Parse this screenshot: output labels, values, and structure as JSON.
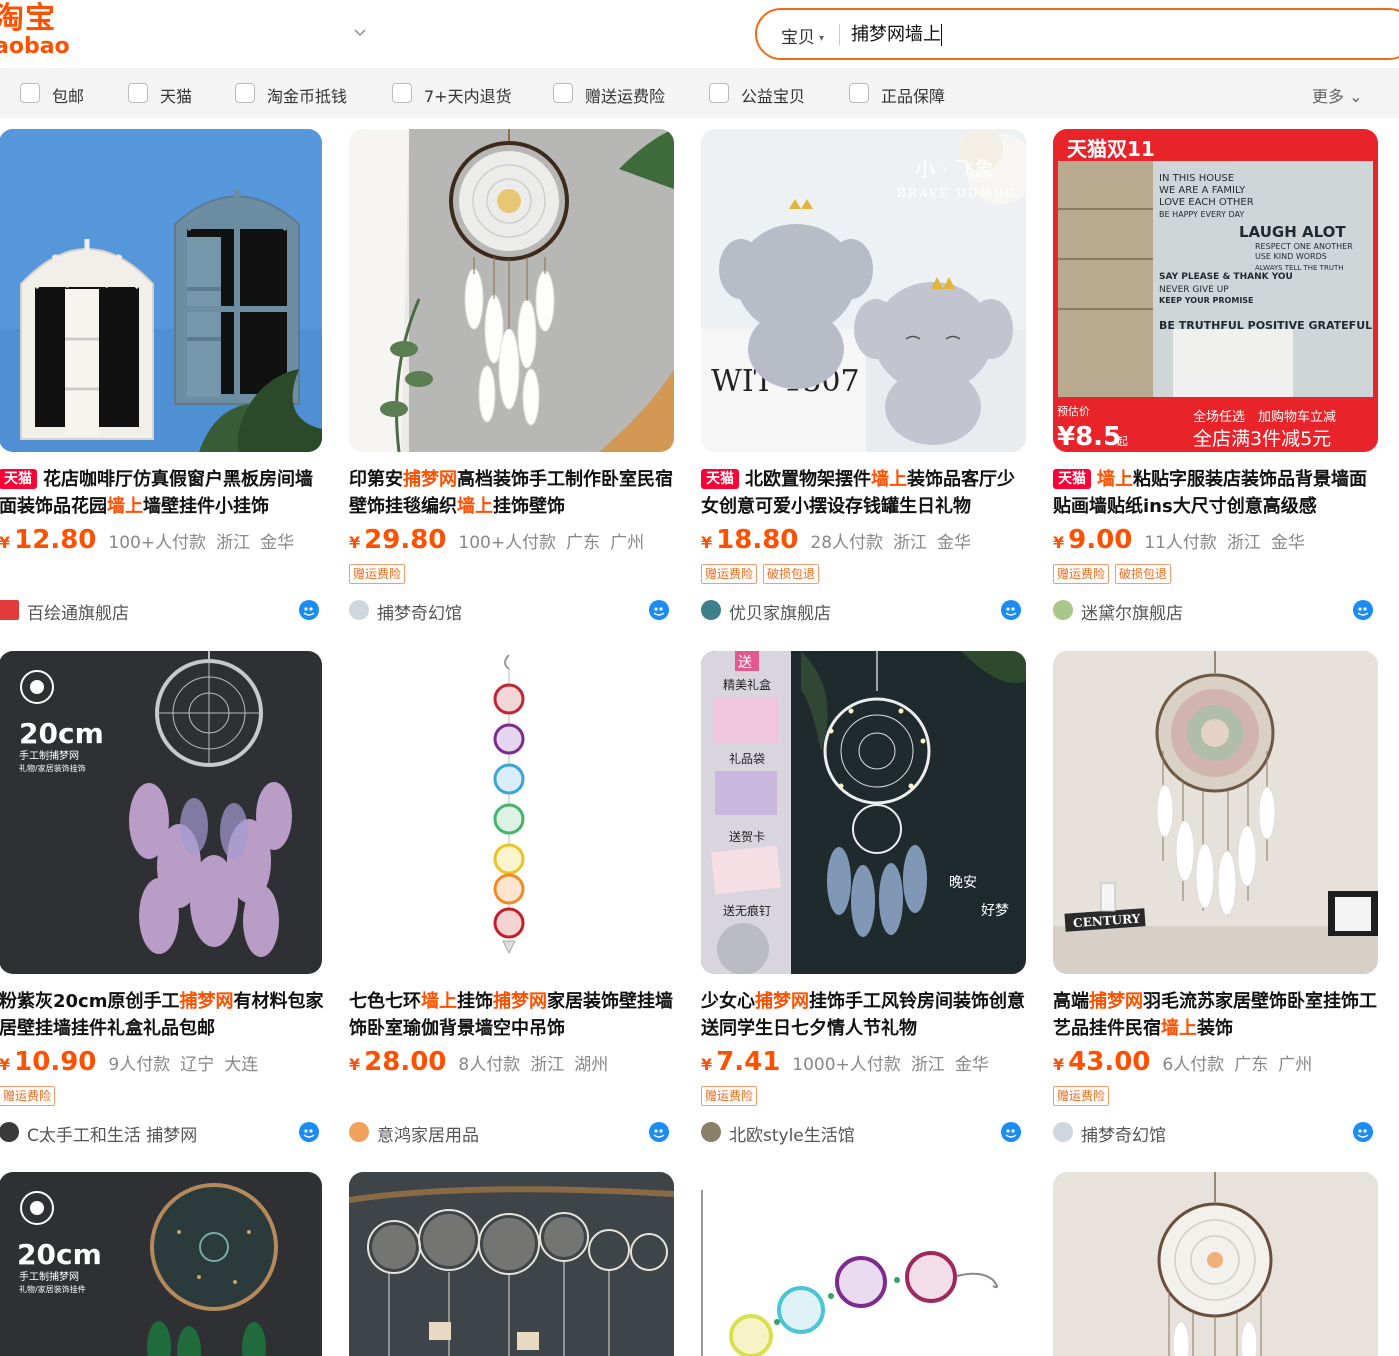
{
  "header": {
    "logo_cn": "淘宝",
    "logo_en": "aobao",
    "search_type": "宝贝",
    "search_value": "捕梦网墙上",
    "icons": {
      "dropdown": "chevron-down-icon",
      "search_type_caret": "caret-down-icon"
    }
  },
  "filters": [
    {
      "label": "包邮"
    },
    {
      "label": "天猫"
    },
    {
      "label": "淘金币抵钱"
    },
    {
      "label": "7+天内退货"
    },
    {
      "label": "赠送运费险"
    },
    {
      "label": "公益宝贝"
    },
    {
      "label": "正品保障"
    }
  ],
  "more_label": "更多",
  "colors": {
    "accent": "#ff5000",
    "tmall": "#ff0036",
    "search_border": "#f06a1a",
    "chat": "#1b8cf2"
  },
  "products": [
    {
      "tmall": "天猫",
      "title_parts": [
        "花店咖啡厅仿真假窗户黑板房间墙面装饰品花园",
        "墙上",
        "墙壁挂件小挂饰"
      ],
      "currency": "¥",
      "price": "12.80",
      "sales": "100+人付款",
      "province": "浙江",
      "city": "金华",
      "tags": [],
      "shop": "百绘通旗舰店"
    },
    {
      "tmall": "",
      "title_parts": [
        "印第安",
        "捕梦网",
        "高档装饰手工制作卧室民宿壁饰挂毯编织",
        "墙上",
        "挂饰壁饰"
      ],
      "currency": "¥",
      "price": "29.80",
      "sales": "100+人付款",
      "province": "广东",
      "city": "广州",
      "tags": [
        "赠运费险"
      ],
      "shop": "捕梦奇幻馆"
    },
    {
      "tmall": "天猫",
      "title_parts": [
        "北欧置物架摆件",
        "墙上",
        "装饰品客厅少女创意可爱小摆设存钱罐生日礼物"
      ],
      "currency": "¥",
      "price": "18.80",
      "sales": "28人付款",
      "province": "浙江",
      "city": "金华",
      "tags": [
        "赠运费险",
        "破损包退"
      ],
      "shop": "优贝家旗舰店"
    },
    {
      "tmall": "天猫",
      "title_parts": [
        "",
        "墙上",
        "粘贴字服装店装饰品背景墙面贴画墙贴纸ins大尺寸创意高级感"
      ],
      "currency": "¥",
      "price": "9.00",
      "sales": "11人付款",
      "province": "浙江",
      "city": "金华",
      "tags": [
        "赠运费险",
        "破损包退"
      ],
      "shop": "迷黛尔旗舰店",
      "promo": {
        "badge": "天猫双11",
        "est_label": "预估价",
        "est_price": "¥8.5",
        "est_suffix": "起",
        "line1": "全场任选　加购物车立减",
        "line2": "全店满3件减5元",
        "poster": [
          "IN THIS HOUSE",
          "WE ARE A FAMILY",
          "LOVE EACH OTHER",
          "BE HAPPY EVERY DAY",
          "LAUGH ALOT",
          "RESPECT ONE ANOTHER",
          "USE KIND WORDS",
          "ALWAYS TELL THE TRUTH",
          "SAY PLEASE & THANK YOU",
          "NEVER GIVE UP",
          "KEEP YOUR PROMISE",
          "BE TRUTHFUL POSITIVE GRATEFUL"
        ]
      }
    },
    {
      "tmall": "",
      "title_parts": [
        "粉紫灰20cm原创手工",
        "捕梦网",
        "有材料包家居壁挂墙挂件礼盒礼品包邮"
      ],
      "currency": "¥",
      "price": "10.90",
      "sales": "9人付款",
      "province": "辽宁",
      "city": "大连",
      "tags": [
        "赠运费险"
      ],
      "shop": "C太手工和生活 捕梦网",
      "overlay": {
        "size": "20cm",
        "sub1": "手工制捕梦网",
        "sub2": "礼物/家居装饰挂饰"
      }
    },
    {
      "tmall": "",
      "title_parts": [
        "七色七环",
        "墙上",
        "挂饰",
        "捕梦网",
        "家居装饰壁挂墙饰卧室瑜伽背景墙空中吊饰"
      ],
      "currency": "¥",
      "price": "28.00",
      "sales": "8人付款",
      "province": "浙江",
      "city": "湖州",
      "tags": [],
      "shop": "意鸿家居用品"
    },
    {
      "tmall": "",
      "title_parts": [
        "少女心",
        "捕梦网",
        "挂饰手工风铃房间装饰创意送同学生日七夕情人节礼物"
      ],
      "currency": "¥",
      "price": "7.41",
      "sales": "1000+人付款",
      "province": "浙江",
      "city": "金华",
      "tags": [
        "赠运费险"
      ],
      "shop": "北欧style生活馆",
      "overlay": {
        "gift": "送",
        "box": "精美礼盒",
        "bag": "礼品袋",
        "card": "送贺卡",
        "nail": "送无痕钉",
        "night1": "晚安",
        "night2": "好梦"
      }
    },
    {
      "tmall": "",
      "title_parts": [
        "高端",
        "捕梦网",
        "羽毛流苏家居壁饰卧室挂饰工艺品挂件民宿",
        "墙上",
        "装饰"
      ],
      "currency": "¥",
      "price": "43.00",
      "sales": "6人付款",
      "province": "广东",
      "city": "广州",
      "tags": [
        "赠运费险"
      ],
      "shop": "捕梦奇幻馆",
      "overlay": {
        "book": "CENTURY"
      }
    },
    {
      "overlay": {
        "size": "20cm",
        "sub1": "手工制捕梦网",
        "sub2": "礼物/家居装饰挂件"
      }
    },
    {},
    {},
    {}
  ],
  "image_overlays": {
    "elephant_brand_cn": "小 · 飞象",
    "elephant_brand_en": "BRAVE DUMBO",
    "elephant_box": "WIT 1507"
  }
}
